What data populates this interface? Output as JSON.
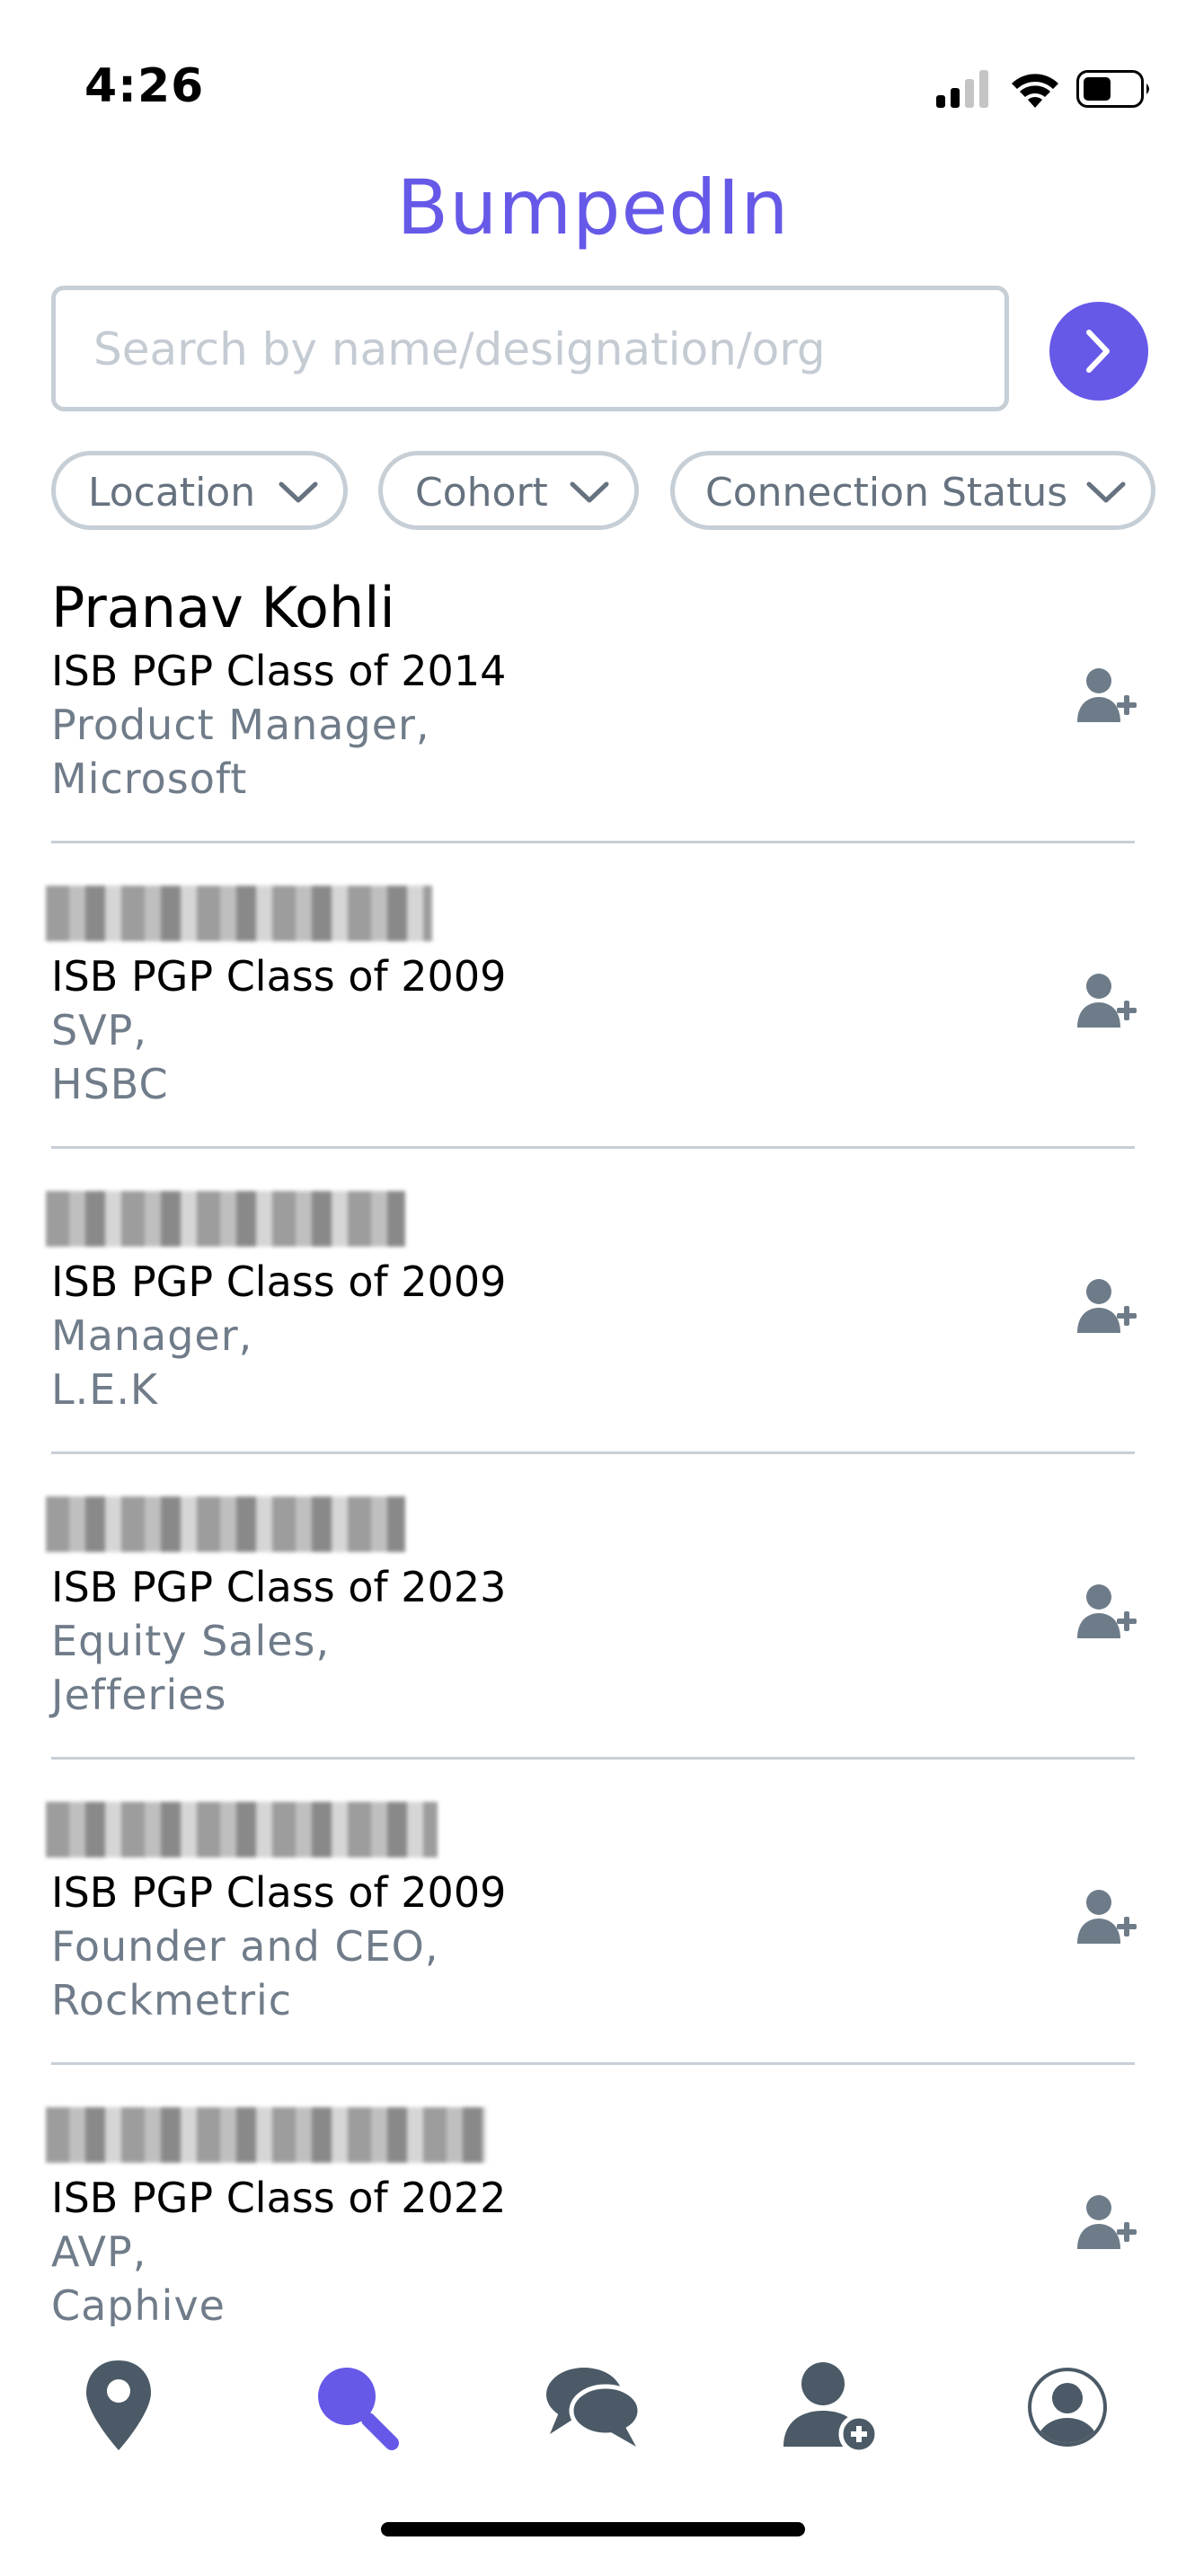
{
  "status_bar": {
    "time": "4:26"
  },
  "app": {
    "title": "BumpedIn"
  },
  "search": {
    "placeholder": "Search by name/designation/org",
    "value": ""
  },
  "filters": [
    {
      "label": "Location"
    },
    {
      "label": "Cohort"
    },
    {
      "label": "Connection Status"
    }
  ],
  "results": [
    {
      "name": "Pranav Kohli",
      "name_obscured": false,
      "cohort": "ISB PGP Class of 2014",
      "designation": "Product Manager,",
      "org": "Microsoft"
    },
    {
      "name": "",
      "name_obscured": true,
      "cohort": "ISB PGP Class of 2009",
      "designation": "SVP,",
      "org": "HSBC"
    },
    {
      "name": "",
      "name_obscured": true,
      "cohort": "ISB PGP Class of 2009",
      "designation": "Manager,",
      "org": "L.E.K"
    },
    {
      "name": "",
      "name_obscured": true,
      "cohort": "ISB PGP Class of 2023",
      "designation": "Equity Sales,",
      "org": "Jefferies"
    },
    {
      "name": "",
      "name_obscured": true,
      "cohort": "ISB PGP Class of 2009",
      "designation": "Founder and CEO,",
      "org": "Rockmetric"
    },
    {
      "name": "",
      "name_obscured": true,
      "cohort": "ISB PGP Class of 2022",
      "designation": "AVP,",
      "org": "Caphive"
    }
  ],
  "tab_bar": {
    "items": [
      {
        "icon": "map-pin-icon",
        "active": false
      },
      {
        "icon": "search-icon",
        "active": true
      },
      {
        "icon": "chat-icon",
        "active": false
      },
      {
        "icon": "add-contact-icon",
        "active": false
      },
      {
        "icon": "profile-icon",
        "active": false
      }
    ]
  },
  "colors": {
    "accent": "#6659e8",
    "icon_gray": "#4b5a66",
    "muted_text": "#707c89",
    "border": "#c6ced6"
  }
}
